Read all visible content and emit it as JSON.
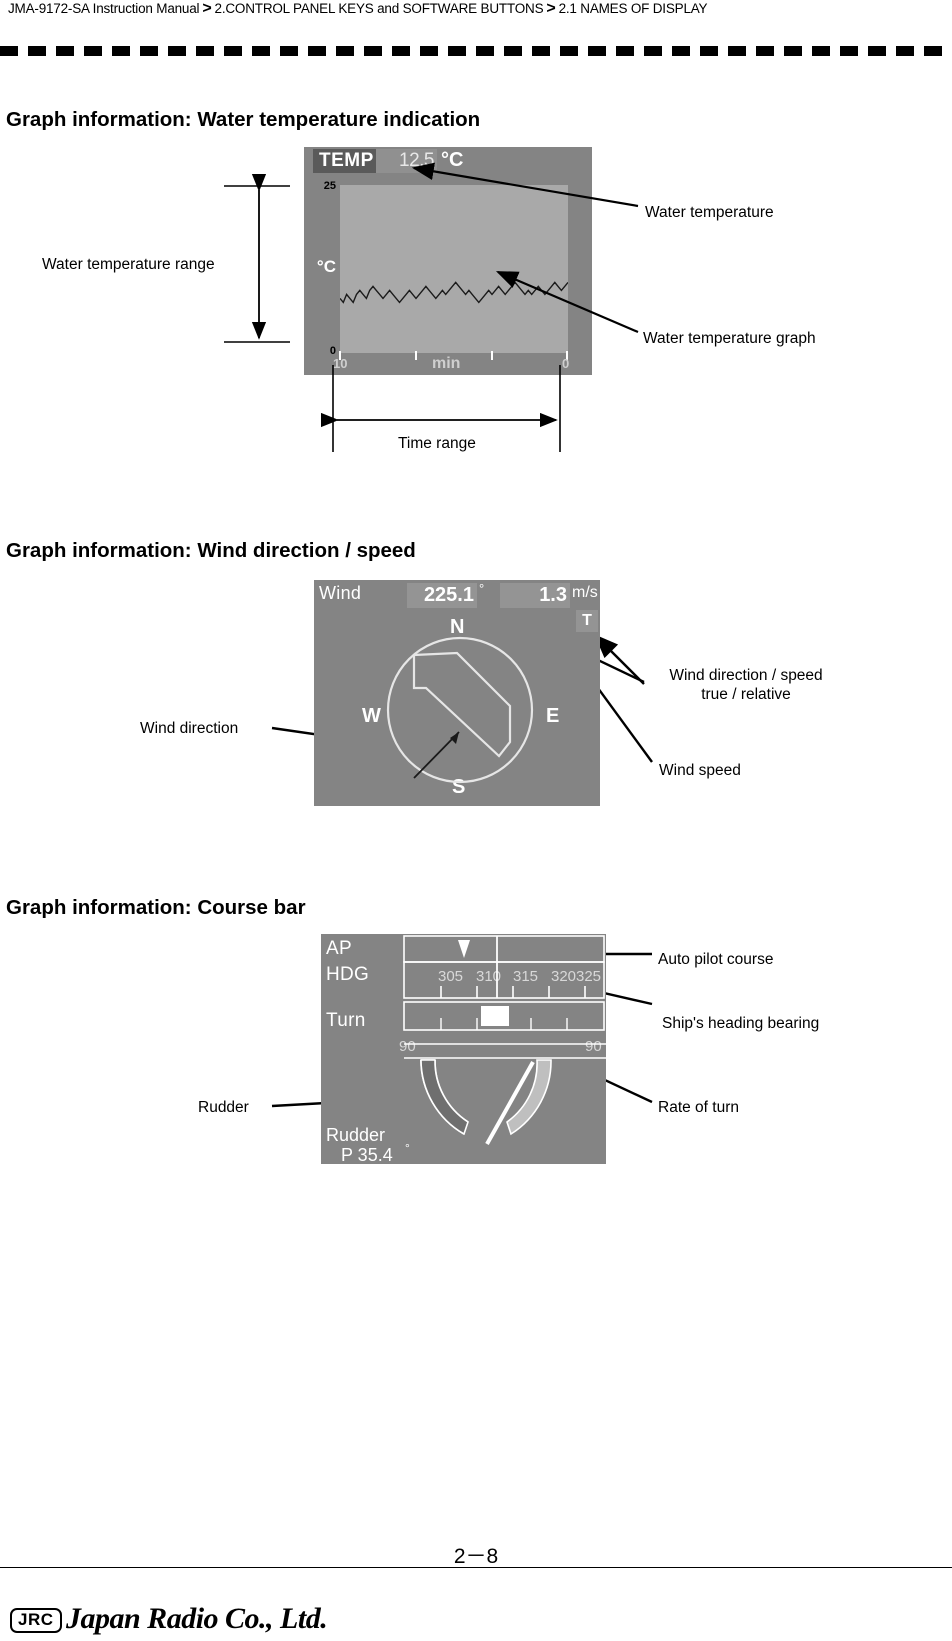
{
  "header": {
    "manual": "JMA-9172-SA Instruction Manual",
    "sep1": ">",
    "chapter": "2.CONTROL PANEL KEYS and SOFTWARE BUTTONS",
    "sep2": ">",
    "section": "2.1  NAMES OF DISPLAY"
  },
  "sections": [
    {
      "title": "Graph information: Water temperature indication"
    },
    {
      "title": "Graph information: Wind direction / speed"
    },
    {
      "title": "Graph information: Course bar"
    }
  ],
  "temperature_panel": {
    "tag": "TEMP",
    "value": "12.5",
    "unit": "°C",
    "y_top_label": "25",
    "y_mid_label": "°C",
    "y_bottom_label": "0",
    "x_left_label": "10",
    "x_center_label": "min",
    "x_right_label": "0",
    "callouts": {
      "water_temperature": "Water temperature",
      "water_temperature_graph": "Water temperature graph",
      "water_temperature_range": "Water temperature range",
      "time_range": "Time range"
    }
  },
  "wind_panel": {
    "label": "Wind",
    "direction": "225.1",
    "direction_unit": "°",
    "speed": "1.3",
    "speed_unit": "m/s",
    "true_relative": "T",
    "compass": {
      "north": "N",
      "east": "E",
      "south": "S",
      "west": "W"
    },
    "callouts": {
      "wind_direction": "Wind direction",
      "wind_dir_speed_line1": "Wind direction / speed",
      "wind_dir_speed_line2": "true / relative",
      "wind_speed": "Wind speed"
    }
  },
  "course_panel": {
    "ap_label": "AP",
    "hdg_label": "HDG",
    "turn_label": "Turn",
    "rudder_label": "Rudder",
    "rudder_value": "P  35.4",
    "rudder_unit": "°",
    "heading_scale": [
      "305",
      "310",
      "315",
      "320",
      "325"
    ],
    "turn_left_label": "90",
    "turn_right_label": "90",
    "callouts": {
      "auto_pilot_course": "Auto pilot course",
      "ship_heading_bearing": "Ship's heading bearing",
      "rate_of_turn": "Rate of turn",
      "rudder": "Rudder"
    }
  },
  "chart_data": {
    "type": "line",
    "title": "Water temperature indication",
    "xlabel": "min",
    "ylabel": "°C",
    "xlim": [
      10,
      0
    ],
    "ylim": [
      0,
      25
    ],
    "x_ticks": [
      "10",
      "",
      "",
      "0"
    ],
    "y_ticks": [
      "0",
      "°C",
      "25"
    ],
    "current_value": 12.5,
    "series": [
      {
        "name": "Water temperature",
        "values": [
          12.4,
          12.3,
          12.5,
          12.4,
          12.3,
          12.5,
          12.6,
          12.5,
          12.4,
          12.6,
          12.7,
          12.6,
          12.5,
          12.4,
          12.5,
          12.6,
          12.5,
          12.4,
          12.3,
          12.4,
          12.5,
          12.6,
          12.5,
          12.4,
          12.5,
          12.6,
          12.7,
          12.6,
          12.5,
          12.4,
          12.5,
          12.6,
          12.5,
          12.6,
          12.7,
          12.8,
          12.7,
          12.6,
          12.5,
          12.6,
          12.5,
          12.4,
          12.3,
          12.4,
          12.5,
          12.6,
          12.5,
          12.6,
          12.7,
          12.6,
          12.5,
          12.6,
          12.7,
          12.8,
          12.7,
          12.6,
          12.5,
          12.6,
          12.5,
          12.6,
          12.7,
          12.6,
          12.5,
          12.6,
          12.7,
          12.8,
          12.7,
          12.6,
          12.7,
          12.8
        ]
      }
    ],
    "grid": false,
    "legend": "none"
  },
  "footer": {
    "brand_mark": "JRC",
    "brand_name": "Japan Radio Co., Ltd.",
    "page_number": "2－8"
  }
}
